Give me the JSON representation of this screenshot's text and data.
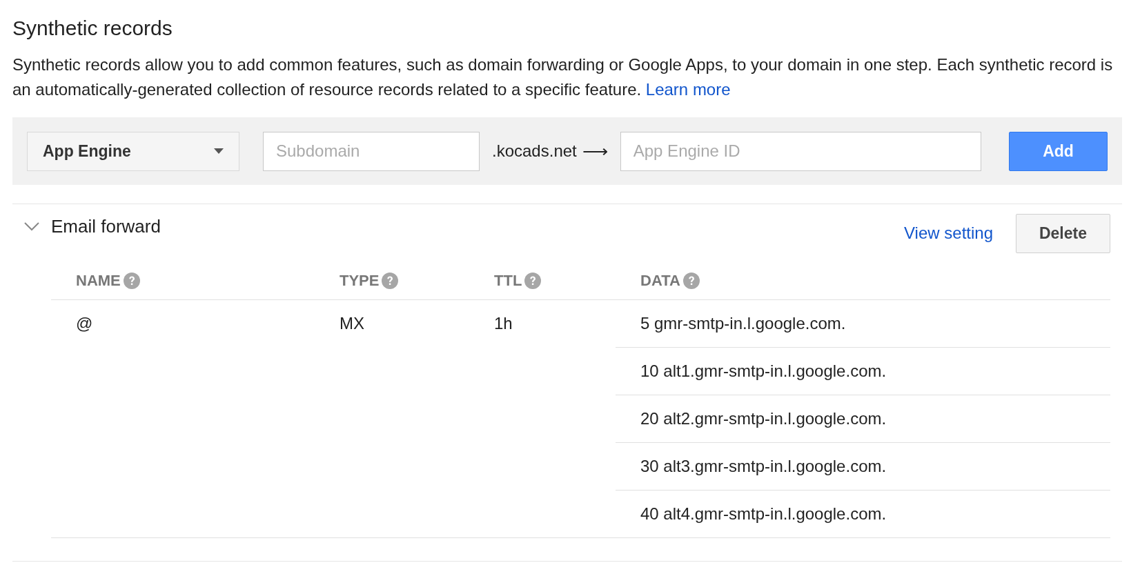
{
  "title": "Synthetic records",
  "description": "Synthetic records allow you to add common features, such as domain forwarding or Google Apps, to your domain in one step. Each synthetic record is an automatically-generated collection of resource records related to a specific feature.",
  "learn_more": "Learn more",
  "toolbar": {
    "type_dropdown": "App Engine",
    "subdomain": {
      "placeholder": "Subdomain"
    },
    "domain_suffix": ".kocads.net",
    "arrow": "⟶",
    "id_field": {
      "placeholder": "App Engine ID"
    },
    "add_button": "Add"
  },
  "records": [
    {
      "name": "Email forward",
      "expanded": true,
      "view_setting": "View setting",
      "delete_button": "Delete",
      "columns": [
        "NAME",
        "TYPE",
        "TTL",
        "DATA"
      ],
      "rows": [
        {
          "name": "@",
          "type": "MX",
          "ttl": "1h",
          "data": [
            "5 gmr-smtp-in.l.google.com.",
            "10 alt1.gmr-smtp-in.l.google.com.",
            "20 alt2.gmr-smtp-in.l.google.com.",
            "30 alt3.gmr-smtp-in.l.google.com.",
            "40 alt4.gmr-smtp-in.l.google.com."
          ]
        }
      ]
    }
  ]
}
